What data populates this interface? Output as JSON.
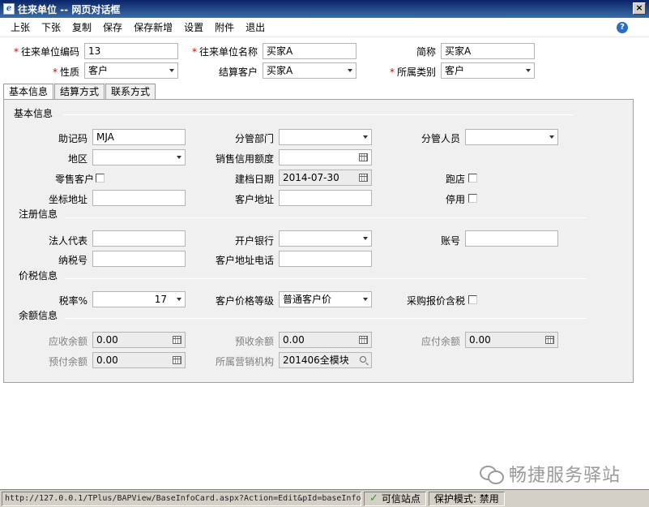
{
  "window": {
    "title": "往来单位 -- 网页对话框",
    "app_icon_glyph": "e",
    "close_glyph": "×"
  },
  "menu": [
    "上张",
    "下张",
    "复制",
    "保存",
    "保存新增",
    "设置",
    "附件",
    "退出"
  ],
  "help_glyph": "?",
  "header_form": {
    "code_label": "往来单位编码",
    "code_value": "13",
    "name_label": "往来单位名称",
    "name_value": "买家A",
    "short_label": "简称",
    "short_value": "买家A",
    "nature_label": "性质",
    "nature_value": "客户",
    "settle_label": "结算客户",
    "settle_value": "买家A",
    "category_label": "所属类别",
    "category_value": "客户",
    "required_mark": "*"
  },
  "tabs": [
    "基本信息",
    "结算方式",
    "联系方式"
  ],
  "sections": {
    "basic": "基本信息",
    "register": "注册信息",
    "tax": "价税信息",
    "balance": "余额信息"
  },
  "basic": {
    "mnemonic_label": "助记码",
    "mnemonic_value": "MJA",
    "dept_label": "分管部门",
    "dept_value": "",
    "staff_label": "分管人员",
    "staff_value": "",
    "region_label": "地区",
    "region_value": "",
    "credit_label": "销售信用额度",
    "credit_value": "",
    "retail_label": "零售客户",
    "created_label": "建档日期",
    "created_value": "2014-07-30",
    "runaway_label": "跑店",
    "coord_label": "坐标地址",
    "coord_value": "",
    "address_label": "客户地址",
    "address_value": "",
    "disabled_label": "停用"
  },
  "register": {
    "legal_label": "法人代表",
    "legal_value": "",
    "bank_label": "开户银行",
    "bank_value": "",
    "account_label": "账号",
    "account_value": "",
    "taxno_label": "纳税号",
    "taxno_value": "",
    "addrphone_label": "客户地址电话",
    "addrphone_value": ""
  },
  "tax": {
    "rate_label": "税率%",
    "rate_value": "17",
    "price_level_label": "客户价格等级",
    "price_level_value": "普通客户价",
    "purchase_tax_label": "采购报价含税"
  },
  "balance": {
    "receivable_label": "应收余额",
    "receivable_value": "0.00",
    "advance_recv_label": "预收余额",
    "advance_recv_value": "0.00",
    "payable_label": "应付余额",
    "payable_value": "0.00",
    "prepaid_label": "预付余额",
    "prepaid_value": "0.00",
    "org_label": "所属营销机构",
    "org_value": "201406全模块"
  },
  "status": {
    "url": "http://127.0.0.1/TPlus/BAPView/BaseInfoCard.aspx?Action=Edit&pId=baseInfo(",
    "zone": "可信站点",
    "protected_mode": "保护模式: 禁用"
  },
  "watermark": "畅捷服务驿站"
}
